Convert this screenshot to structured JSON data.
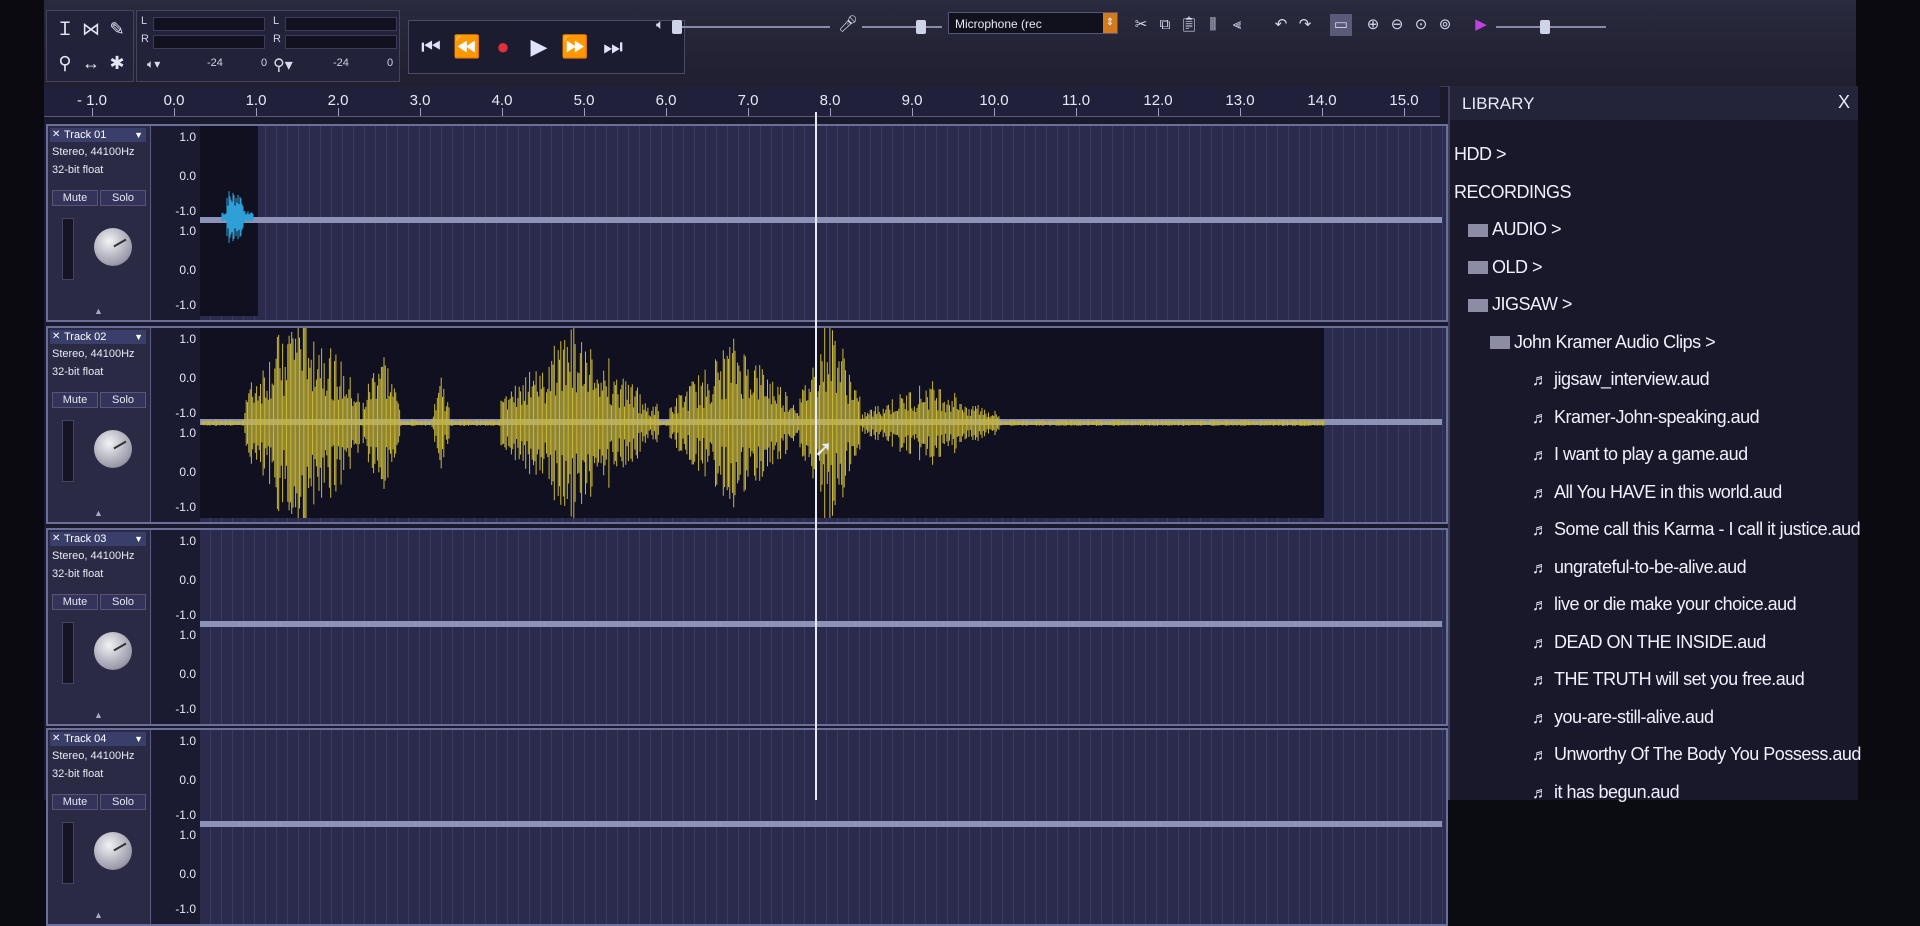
{
  "toolbar": {
    "meter_l": "L",
    "meter_r": "R",
    "scale_minus24": "-24",
    "scale_0": "0",
    "input_device": "Microphone (rec"
  },
  "ruler": {
    "ticks": [
      "- 1.0",
      "0.0",
      "1.0",
      "2.0",
      "3.0",
      "4.0",
      "5.0",
      "6.0",
      "7.0",
      "8.0",
      "9.0",
      "10.0",
      "11.0",
      "12.0",
      "13.0",
      "14.0",
      "15.0"
    ]
  },
  "tracks": [
    {
      "name": "Track 01",
      "format": "Stereo, 44100Hz",
      "depth": "32-bit float",
      "mute": "Mute",
      "solo": "Solo",
      "waveform": "short-blue"
    },
    {
      "name": "Track 02",
      "format": "Stereo, 44100Hz",
      "depth": "32-bit float",
      "mute": "Mute",
      "solo": "Solo",
      "waveform": "yellow-speech"
    },
    {
      "name": "Track 03",
      "format": "Stereo, 44100Hz",
      "depth": "32-bit float",
      "mute": "Mute",
      "solo": "Solo",
      "waveform": "empty"
    },
    {
      "name": "Track 04",
      "format": "Stereo, 44100Hz",
      "depth": "32-bit float",
      "mute": "Mute",
      "solo": "Solo",
      "waveform": "empty"
    }
  ],
  "scale_labels": [
    "1.0",
    "0.0",
    "-1.0",
    "1.0",
    "0.0",
    "-1.0"
  ],
  "colors": {
    "wave_blue": "#2f9fd8",
    "wave_yellow": "#c8b83a",
    "accent": "#6b6f9c"
  },
  "library": {
    "title": "LIBRARY",
    "close": "X",
    "items": [
      {
        "label": "HDD >",
        "type": "root",
        "indent": 0
      },
      {
        "label": "RECORDINGS",
        "type": "root",
        "indent": 0
      },
      {
        "label": "AUDIO >",
        "type": "folder",
        "indent": 1
      },
      {
        "label": "OLD >",
        "type": "folder",
        "indent": 1
      },
      {
        "label": "JIGSAW >",
        "type": "folder",
        "indent": 1
      },
      {
        "label": "John Kramer Audio Clips >",
        "type": "folder",
        "indent": 2
      },
      {
        "label": "jigsaw_interview.aud",
        "type": "file",
        "indent": 3
      },
      {
        "label": "Kramer-John-speaking.aud",
        "type": "file",
        "indent": 3
      },
      {
        "label": "I want to play a game.aud",
        "type": "file",
        "indent": 3
      },
      {
        "label": "All You HAVE in this world.aud",
        "type": "file",
        "indent": 3
      },
      {
        "label": "Some call this Karma - I call it justice.aud",
        "type": "file",
        "indent": 3
      },
      {
        "label": "ungrateful-to-be-alive.aud",
        "type": "file",
        "indent": 3
      },
      {
        "label": "live or die make your choice.aud",
        "type": "file",
        "indent": 3
      },
      {
        "label": "DEAD ON THE INSIDE.aud",
        "type": "file",
        "indent": 3
      },
      {
        "label": "THE TRUTH will set you free.aud",
        "type": "file",
        "indent": 3
      },
      {
        "label": "you-are-still-alive.aud",
        "type": "file",
        "indent": 3
      },
      {
        "label": "Unworthy Of The Body You Possess.aud",
        "type": "file",
        "indent": 3
      },
      {
        "label": "it has begun.aud",
        "type": "file",
        "indent": 3
      }
    ]
  }
}
